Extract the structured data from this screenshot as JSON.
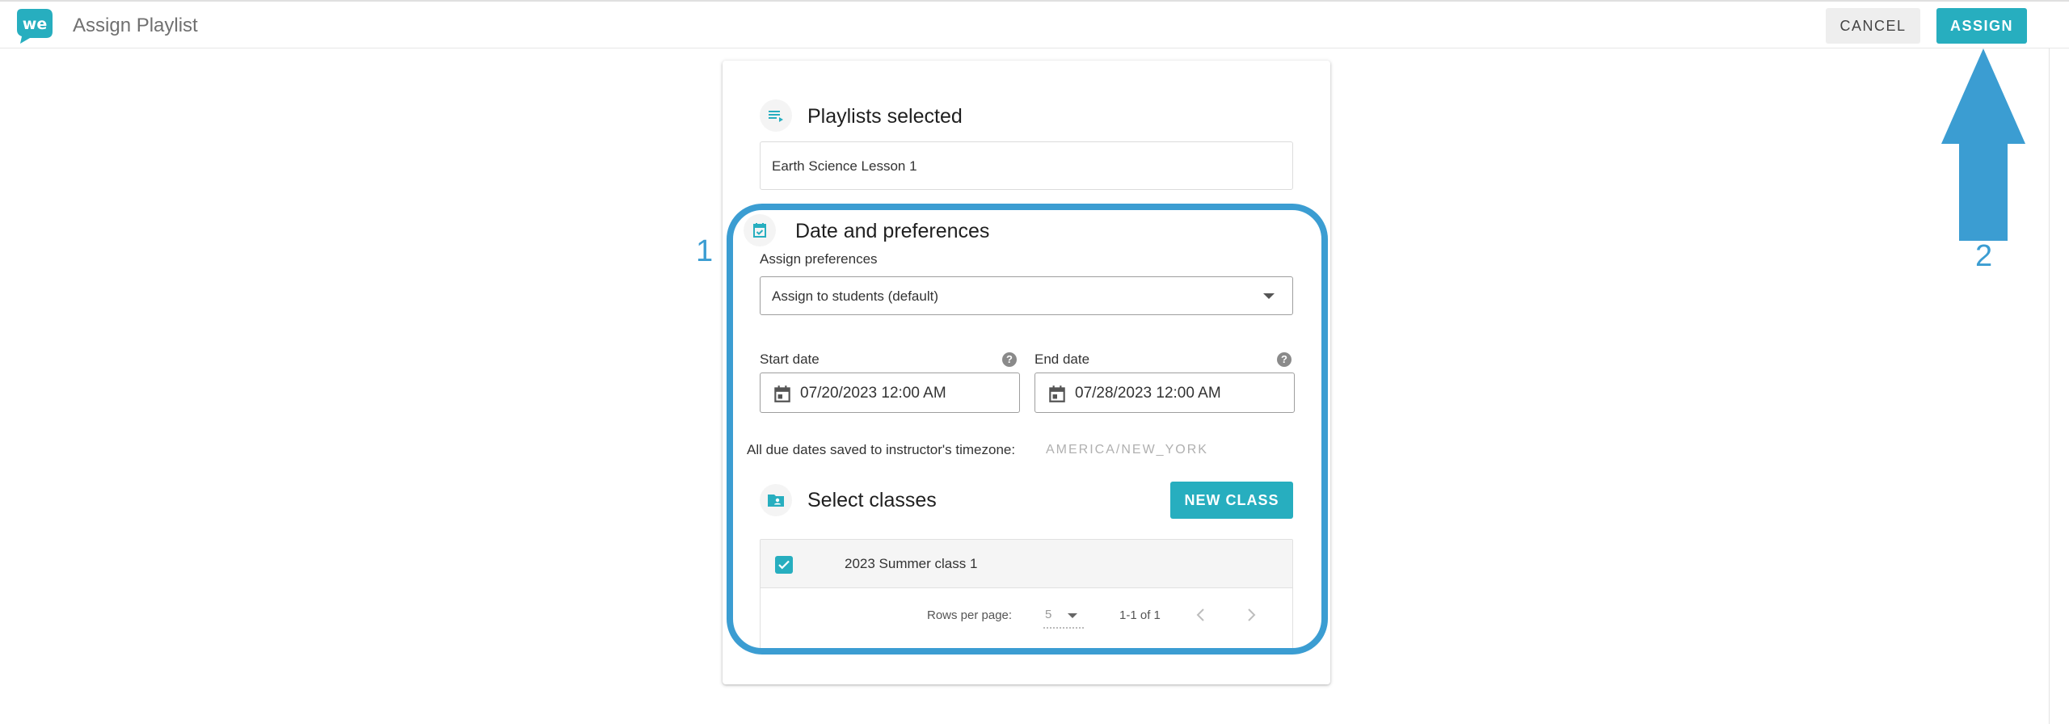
{
  "header": {
    "logo_text": "we",
    "title": "Assign Playlist",
    "cancel_label": "CANCEL",
    "assign_label": "ASSIGN"
  },
  "playlists": {
    "title": "Playlists selected",
    "selected": "Earth Science Lesson 1"
  },
  "preferences": {
    "title": "Date and preferences",
    "assign_label": "Assign preferences",
    "assign_value": "Assign to students (default)",
    "start_label": "Start date",
    "start_value": "07/20/2023 12:00 AM",
    "end_label": "End date",
    "end_value": "07/28/2023 12:00 AM",
    "timezone_label": "All due dates saved to instructor's timezone:",
    "timezone_value": "AMERICA/NEW_YORK"
  },
  "classes": {
    "title": "Select classes",
    "new_class_label": "NEW CLASS",
    "rows": [
      {
        "name": "2023 Summer class 1",
        "checked": true
      }
    ],
    "rows_per_page_label": "Rows per page:",
    "rows_per_page_value": "5",
    "page_range": "1-1 of 1"
  },
  "annotations": {
    "label_1": "1",
    "label_2": "2",
    "color": "#3b9dd2"
  },
  "colors": {
    "accent": "#27aebf"
  }
}
